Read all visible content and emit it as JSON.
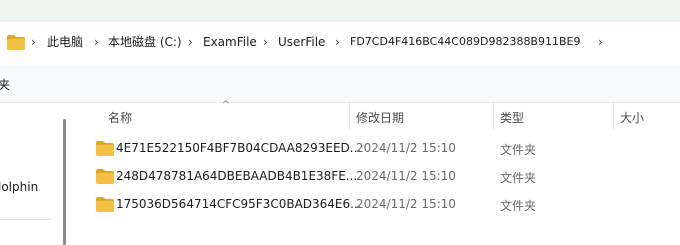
{
  "breadcrumb": {
    "items": [
      "此电脑",
      "本地磁盘 (C:)",
      "ExamFile",
      "UserFile",
      "FD7CD4F416BC44C089D982388B911BE9"
    ],
    "separator": "›"
  },
  "toolbar": {
    "label": "夹"
  },
  "nav": {
    "item_label": "lolphin"
  },
  "columns": {
    "name": "名称",
    "date": "修改日期",
    "type": "类型",
    "size": "大小"
  },
  "rows": [
    {
      "name": "4E71E522150F4BF7B04CDAA8293EED...",
      "date": "2024/11/2 15:10",
      "type": "文件夹"
    },
    {
      "name": "248D478781A64DBEBAADB4B1E38FE...",
      "date": "2024/11/2 15:10",
      "type": "文件夹"
    },
    {
      "name": "175036D564714CFC95F3C0BAD364E6...",
      "date": "2024/11/2 15:10",
      "type": "文件夹"
    }
  ],
  "icons": {
    "folder": "folder-icon",
    "sort": "sort-up-icon"
  },
  "colors": {
    "folder": "#f4c144",
    "folder_tab": "#e0a82b",
    "toolbar_bg": "#f7f9fc",
    "top_strip": "#eef5ee"
  }
}
